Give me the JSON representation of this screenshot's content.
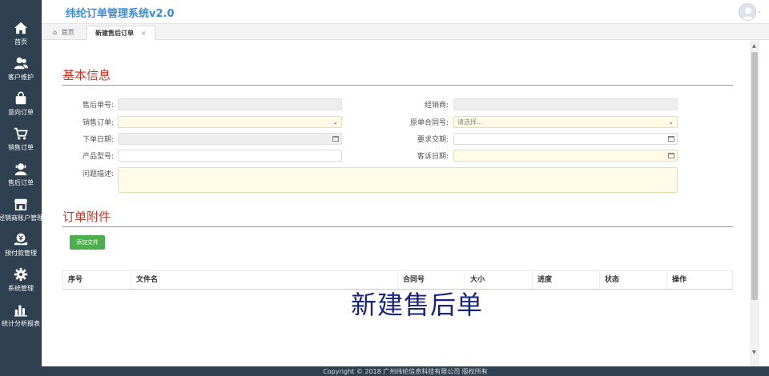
{
  "app": {
    "title": "纬纶订单管理系统v2.0"
  },
  "sidebar": {
    "items": [
      {
        "label": "首页",
        "icon": "home-icon"
      },
      {
        "label": "客户维护",
        "icon": "users-icon"
      },
      {
        "label": "意向订单",
        "icon": "shopping-bag-icon"
      },
      {
        "label": "销售订单",
        "icon": "cart-icon"
      },
      {
        "label": "售后订单",
        "icon": "user-service-icon"
      },
      {
        "label": "经销商账户管理",
        "icon": "store-icon"
      },
      {
        "label": "预付款管理",
        "icon": "money-icon"
      },
      {
        "label": "系统管理",
        "icon": "gear-icon"
      },
      {
        "label": "统计分析报表",
        "icon": "bar-chart-icon"
      }
    ]
  },
  "tabs": {
    "home": "首页",
    "active": "新建售后订单",
    "close": "×"
  },
  "sections": {
    "basic": "基本信息",
    "attachments": "订单附件"
  },
  "form": {
    "after_sales_no": {
      "label": "售后单号:",
      "value": ""
    },
    "dealer": {
      "label": "经销商:",
      "value": ""
    },
    "sales_order": {
      "label": "销售订单:",
      "value": ""
    },
    "contract_no": {
      "label": "原单合同号:",
      "placeholder": "请选择..."
    },
    "order_date": {
      "label": "下单日期:",
      "value": ""
    },
    "delivery_date": {
      "label": "要求交期:",
      "value": ""
    },
    "product_model": {
      "label": "产品型号:",
      "value": ""
    },
    "complaint_date": {
      "label": "客诉日期:",
      "value": ""
    },
    "description": {
      "label": "问题描述:",
      "value": ""
    }
  },
  "attachments": {
    "add_button": "添加文件",
    "columns": [
      "序号",
      "文件名",
      "合同号",
      "大小",
      "进度",
      "状态",
      "操作"
    ]
  },
  "overlay_text": "新建售后单",
  "footer": "Copyright © 2018 广州纬纶信息科技有限公司 版权所有",
  "colors": {
    "sidebar": "#2f4050",
    "title": "#3a8bd8",
    "section": "#c0392b",
    "add_button": "#4cae4c",
    "overlay": "#1a237e"
  }
}
